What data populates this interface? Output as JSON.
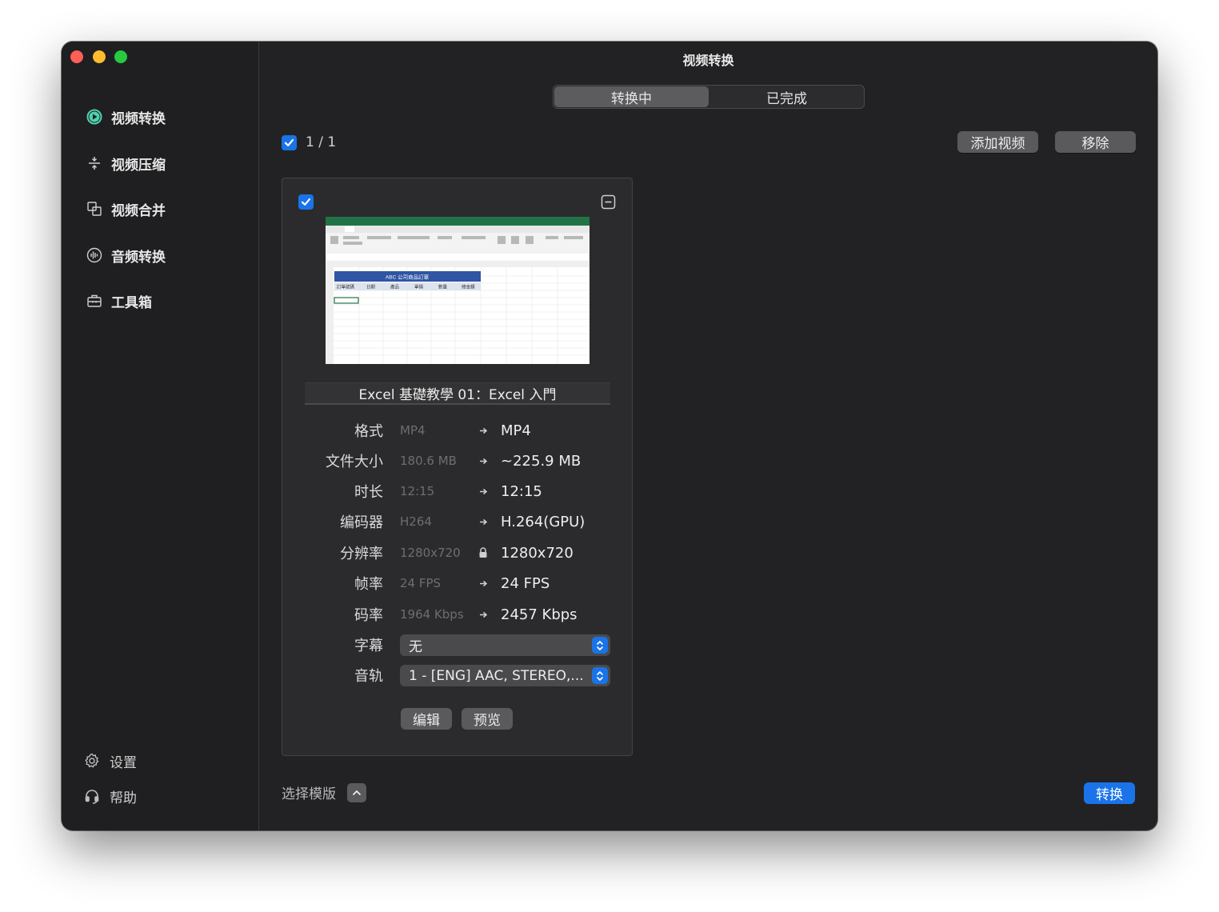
{
  "window": {
    "title": "视频转换"
  },
  "sidebar": {
    "items": [
      {
        "label": "视频转换",
        "icon": "video-convert-icon",
        "active": true
      },
      {
        "label": "视频压缩",
        "icon": "compress-icon"
      },
      {
        "label": "视频合并",
        "icon": "merge-icon"
      },
      {
        "label": "音频转换",
        "icon": "audio-wave-icon"
      },
      {
        "label": "工具箱",
        "icon": "toolbox-icon"
      }
    ],
    "bottom": [
      {
        "label": "设置",
        "icon": "gear-icon"
      },
      {
        "label": "帮助",
        "icon": "headset-icon"
      }
    ]
  },
  "tabs": [
    {
      "label": "转换中",
      "active": true
    },
    {
      "label": "已完成",
      "active": false
    }
  ],
  "toolbar": {
    "selection_count": "1 / 1",
    "add_video": "添加视频",
    "remove": "移除"
  },
  "card": {
    "file_name": "Excel 基礎教學 01：Excel 入門",
    "thumbnail": {
      "sheet_title": "ABC 公司商品訂單",
      "headers": [
        "訂單號碼",
        "日期",
        "產品",
        "單價",
        "數量",
        "總金額"
      ]
    },
    "properties": [
      {
        "label": "格式",
        "source": "MP4",
        "target": "MP4",
        "arrow": "arrow"
      },
      {
        "label": "文件大小",
        "source": "180.6 MB",
        "target": "~225.9 MB",
        "arrow": "arrow"
      },
      {
        "label": "时长",
        "source": "12:15",
        "target": "12:15",
        "arrow": "arrow"
      },
      {
        "label": "编码器",
        "source": "H264",
        "target": "H.264(GPU)",
        "arrow": "arrow"
      },
      {
        "label": "分辨率",
        "source": "1280x720",
        "target": "1280x720",
        "arrow": "lock"
      },
      {
        "label": "帧率",
        "source": "24 FPS",
        "target": "24 FPS",
        "arrow": "arrow"
      },
      {
        "label": "码率",
        "source": "1964 Kbps",
        "target": "2457 Kbps",
        "arrow": "arrow"
      }
    ],
    "subtitle": {
      "label": "字幕",
      "value": "无"
    },
    "audio_track": {
      "label": "音轨",
      "value": "1 - [ENG] AAC, STEREO,..."
    },
    "edit_label": "编辑",
    "preview_label": "预览"
  },
  "footer": {
    "template_label": "选择模版",
    "convert_label": "转换"
  },
  "colors": {
    "accent": "#1a73e8",
    "background": "#222224",
    "sidebar": "#1f1f21",
    "excel_green": "#217346",
    "sheet_header_blue": "#2f55a4"
  }
}
